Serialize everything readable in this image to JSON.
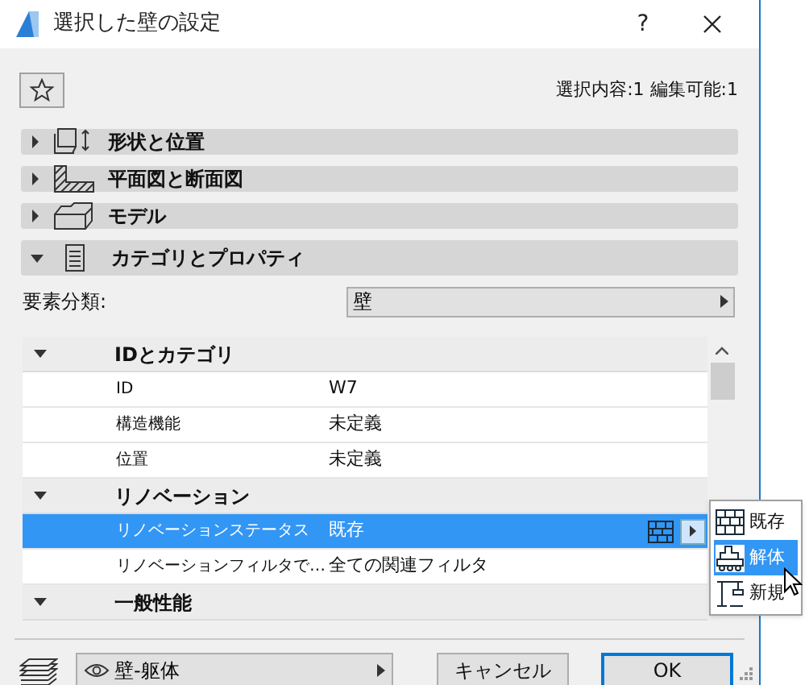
{
  "window": {
    "title": "選択した壁の設定",
    "help": "?"
  },
  "summary": "選択内容:1 編集可能:1",
  "panels": [
    {
      "label": "形状と位置",
      "expanded": false
    },
    {
      "label": "平面図と断面図",
      "expanded": false
    },
    {
      "label": "モデル",
      "expanded": false
    },
    {
      "label": "カテゴリとプロパティ",
      "expanded": true
    }
  ],
  "classification": {
    "label": "要素分類:",
    "value": "壁"
  },
  "groups": [
    {
      "label": "IDとカテゴリ",
      "expanded": true,
      "rows": [
        {
          "name": "ID",
          "value": "W7",
          "selected": false
        },
        {
          "name": "構造機能",
          "value": "未定義",
          "selected": false
        },
        {
          "name": "位置",
          "value": "未定義",
          "selected": false
        }
      ]
    },
    {
      "label": "リノベーション",
      "expanded": true,
      "rows": [
        {
          "name": "リノベーションステータス",
          "value": "既存",
          "selected": true
        },
        {
          "name": "リノベーションフィルタで…",
          "value": "全ての関連フィルタ",
          "selected": false
        }
      ]
    },
    {
      "label": "一般性能",
      "expanded": true
    }
  ],
  "status_menu": [
    {
      "label": "既存",
      "selected": false
    },
    {
      "label": "解体",
      "selected": true
    },
    {
      "label": "新規",
      "selected": false
    }
  ],
  "layer": {
    "value": "壁-躯体"
  },
  "buttons": [
    {
      "label": "キャンセル",
      "kind": "cancel"
    },
    {
      "label": "OK",
      "kind": "default"
    }
  ]
}
